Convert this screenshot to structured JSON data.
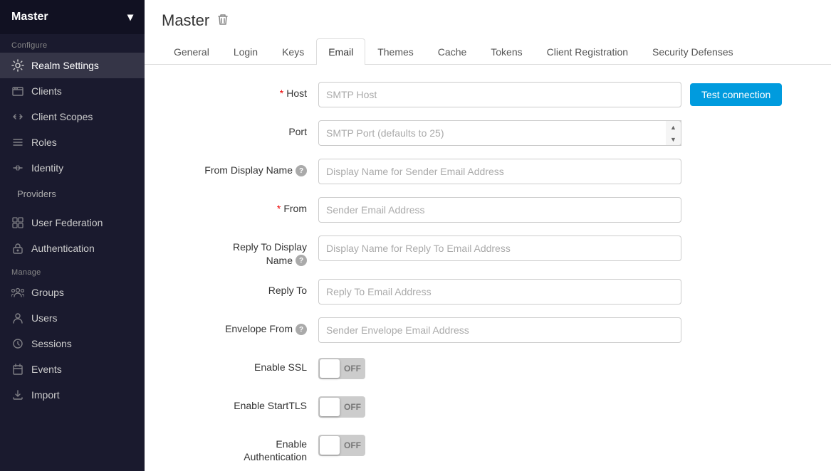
{
  "sidebar": {
    "header": {
      "title": "Master",
      "chevron": "▾"
    },
    "sections": [
      {
        "label": "Configure",
        "items": [
          {
            "id": "realm-settings",
            "label": "Realm Settings",
            "icon": "⚙",
            "active": true
          },
          {
            "id": "clients",
            "label": "Clients",
            "icon": "📋",
            "active": false
          },
          {
            "id": "client-scopes",
            "label": "Client Scopes",
            "icon": "↔",
            "active": false
          },
          {
            "id": "roles",
            "label": "Roles",
            "icon": "≡",
            "active": false
          },
          {
            "id": "identity",
            "label": "Identity",
            "icon": "⇄",
            "active": false
          },
          {
            "id": "providers",
            "label": "Providers",
            "icon": "",
            "active": false
          },
          {
            "id": "user-federation",
            "label": "User Federation",
            "icon": "⊞",
            "active": false
          },
          {
            "id": "authentication",
            "label": "Authentication",
            "icon": "🔒",
            "active": false
          }
        ]
      },
      {
        "label": "Manage",
        "items": [
          {
            "id": "groups",
            "label": "Groups",
            "icon": "👥",
            "active": false
          },
          {
            "id": "users",
            "label": "Users",
            "icon": "👤",
            "active": false
          },
          {
            "id": "sessions",
            "label": "Sessions",
            "icon": "⏱",
            "active": false
          },
          {
            "id": "events",
            "label": "Events",
            "icon": "📅",
            "active": false
          },
          {
            "id": "import",
            "label": "Import",
            "icon": "📥",
            "active": false
          }
        ]
      }
    ]
  },
  "main": {
    "title": "Master",
    "trash_icon": "🗑",
    "tabs": [
      {
        "id": "general",
        "label": "General",
        "active": false
      },
      {
        "id": "login",
        "label": "Login",
        "active": false
      },
      {
        "id": "keys",
        "label": "Keys",
        "active": false
      },
      {
        "id": "email",
        "label": "Email",
        "active": true
      },
      {
        "id": "themes",
        "label": "Themes",
        "active": false
      },
      {
        "id": "cache",
        "label": "Cache",
        "active": false
      },
      {
        "id": "tokens",
        "label": "Tokens",
        "active": false
      },
      {
        "id": "client-registration",
        "label": "Client Registration",
        "active": false
      },
      {
        "id": "security-defenses",
        "label": "Security Defenses",
        "active": false
      }
    ],
    "form": {
      "host_label": "Host",
      "host_placeholder": "SMTP Host",
      "port_label": "Port",
      "port_placeholder": "SMTP Port (defaults to 25)",
      "from_display_name_label": "From Display Name",
      "from_display_name_placeholder": "Display Name for Sender Email Address",
      "from_label": "From",
      "from_placeholder": "Sender Email Address",
      "reply_to_display_name_label_line1": "Reply To Display",
      "reply_to_display_name_label_line2": "Name",
      "reply_to_display_name_placeholder": "Display Name for Reply To Email Address",
      "reply_to_label": "Reply To",
      "reply_to_placeholder": "Reply To Email Address",
      "envelope_from_label": "Envelope From",
      "envelope_from_placeholder": "Sender Envelope Email Address",
      "enable_ssl_label": "Enable SSL",
      "enable_ssl_value": "OFF",
      "enable_starttls_label": "Enable StartTLS",
      "enable_starttls_value": "OFF",
      "enable_authentication_label_line1": "Enable",
      "enable_authentication_label_line2": "Authentication",
      "enable_authentication_value": "OFF",
      "test_connection_btn": "Test connection"
    }
  }
}
